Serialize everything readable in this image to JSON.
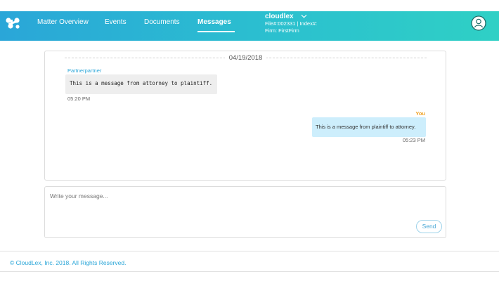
{
  "nav": {
    "items": [
      {
        "label": "Matter Overview"
      },
      {
        "label": "Events"
      },
      {
        "label": "Documents"
      },
      {
        "label": "Messages"
      }
    ],
    "active": "Messages"
  },
  "matter": {
    "name": "cloudlex",
    "file_line": "File#:002331 | Index#:",
    "firm_line": "Firm: FirstFirm"
  },
  "conversation": {
    "date": "04/19/2018",
    "messages": [
      {
        "sender": "Partnerpartner",
        "text": "This is a message from attorney to plaintiff.",
        "time": "05:20 PM"
      },
      {
        "sender": "You",
        "text": "This is a message from plaintiff to attorney.",
        "time": "05:23 PM"
      }
    ]
  },
  "compose": {
    "placeholder": "Write your message...",
    "value": "",
    "send_label": "Send"
  },
  "footer": {
    "copyright": "© CloudLex, Inc. 2018. All Rights Reserved."
  },
  "colors": {
    "header_gradient_start": "#2aa6d8",
    "header_gradient_end": "#2fd0c5",
    "partner_name": "#2aa6d8",
    "you_name": "#f0a020",
    "outgoing_bubble": "#cdeefc",
    "incoming_bubble": "#eeeeee"
  },
  "icons": {
    "logo": "cloudlex-logo-icon",
    "dropdown": "chevron-down-icon",
    "profile": "user-avatar-icon"
  }
}
